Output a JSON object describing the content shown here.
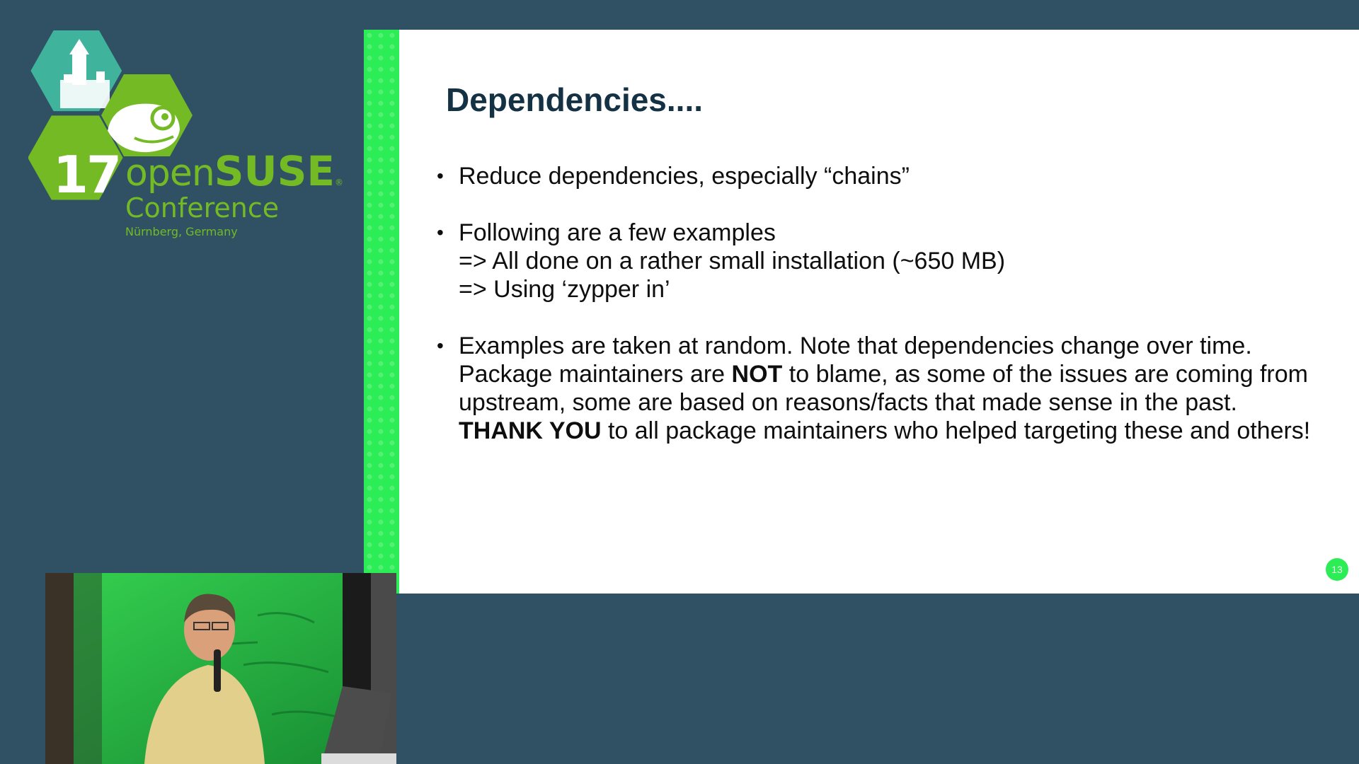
{
  "logo": {
    "number": "17",
    "brand_light": "open",
    "brand_bold": "SUSE",
    "registered_mark": "®",
    "subtitle": "Conference",
    "location": "Nürnberg, Germany",
    "color": "#73ba25"
  },
  "slide": {
    "title": "Dependencies....",
    "accent_color": "#2ded57",
    "page_number": "13",
    "bullets": [
      {
        "lines": [
          "Reduce dependencies, especially “chains”"
        ]
      },
      {
        "lines": [
          "Following are a few examples",
          "=> All done on a rather small installation (~650 MB)",
          "=> Using ‘zypper in’"
        ]
      },
      {
        "line1": "Examples are taken at random. Note that dependencies change over time.",
        "line2_pre": "Package maintainers are ",
        "line2_bold": "NOT",
        "line2_post": " to blame, as some of the issues are coming from upstream, some are based on reasons/facts that made sense in the past.",
        "line3_bold": "THANK YOU",
        "line3_post": " to all package maintainers who helped targeting these and others!"
      }
    ]
  },
  "video": {
    "subject": "speaker-video"
  }
}
